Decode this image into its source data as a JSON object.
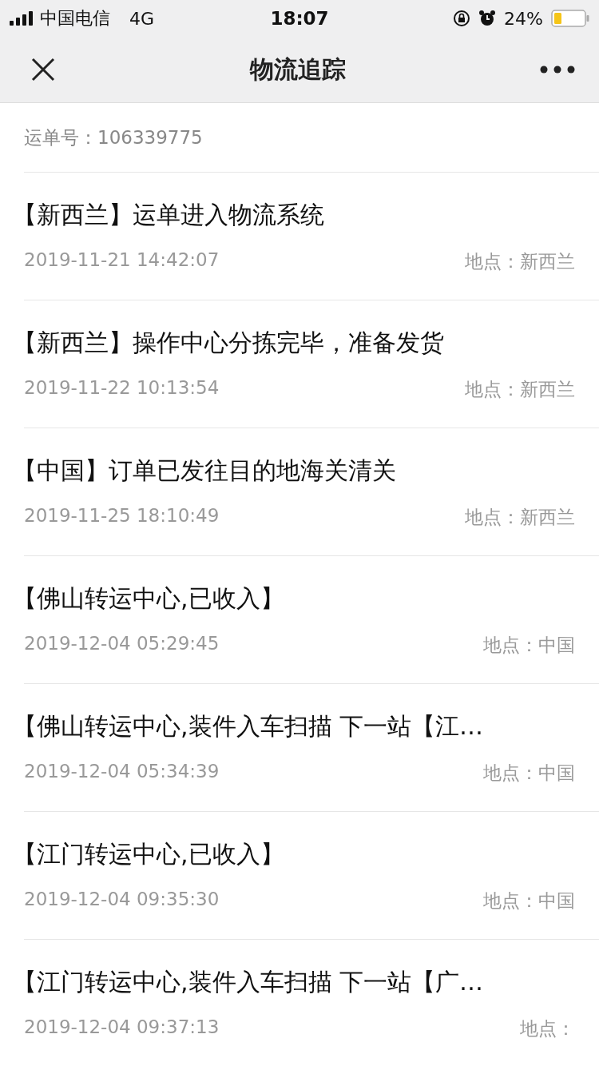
{
  "status_bar": {
    "carrier": "中国电信",
    "network": "4G",
    "time": "18:07",
    "battery": "24%"
  },
  "nav": {
    "title": "物流追踪"
  },
  "waybill": "运单号：106339775",
  "events": [
    {
      "title": "【新西兰】运单进入物流系统",
      "time": "2019-11-21 14:42:07",
      "location": "地点：新西兰"
    },
    {
      "title": "【新西兰】操作中心分拣完毕，准备发货",
      "time": "2019-11-22 10:13:54",
      "location": "地点：新西兰"
    },
    {
      "title": "【中国】订单已发往目的地海关清关",
      "time": "2019-11-25 18:10:49",
      "location": "地点：新西兰"
    },
    {
      "title": "【佛山转运中心,已收入】",
      "time": "2019-12-04 05:29:45",
      "location": "地点：中国"
    },
    {
      "title": "【佛山转运中心,装件入车扫描 下一站【江…",
      "time": "2019-12-04 05:34:39",
      "location": "地点：中国"
    },
    {
      "title": "【江门转运中心,已收入】",
      "time": "2019-12-04 09:35:30",
      "location": "地点：中国"
    },
    {
      "title": "【江门转运中心,装件入车扫描 下一站【广…",
      "time": "2019-12-04 09:37:13",
      "location": "地点："
    }
  ]
}
